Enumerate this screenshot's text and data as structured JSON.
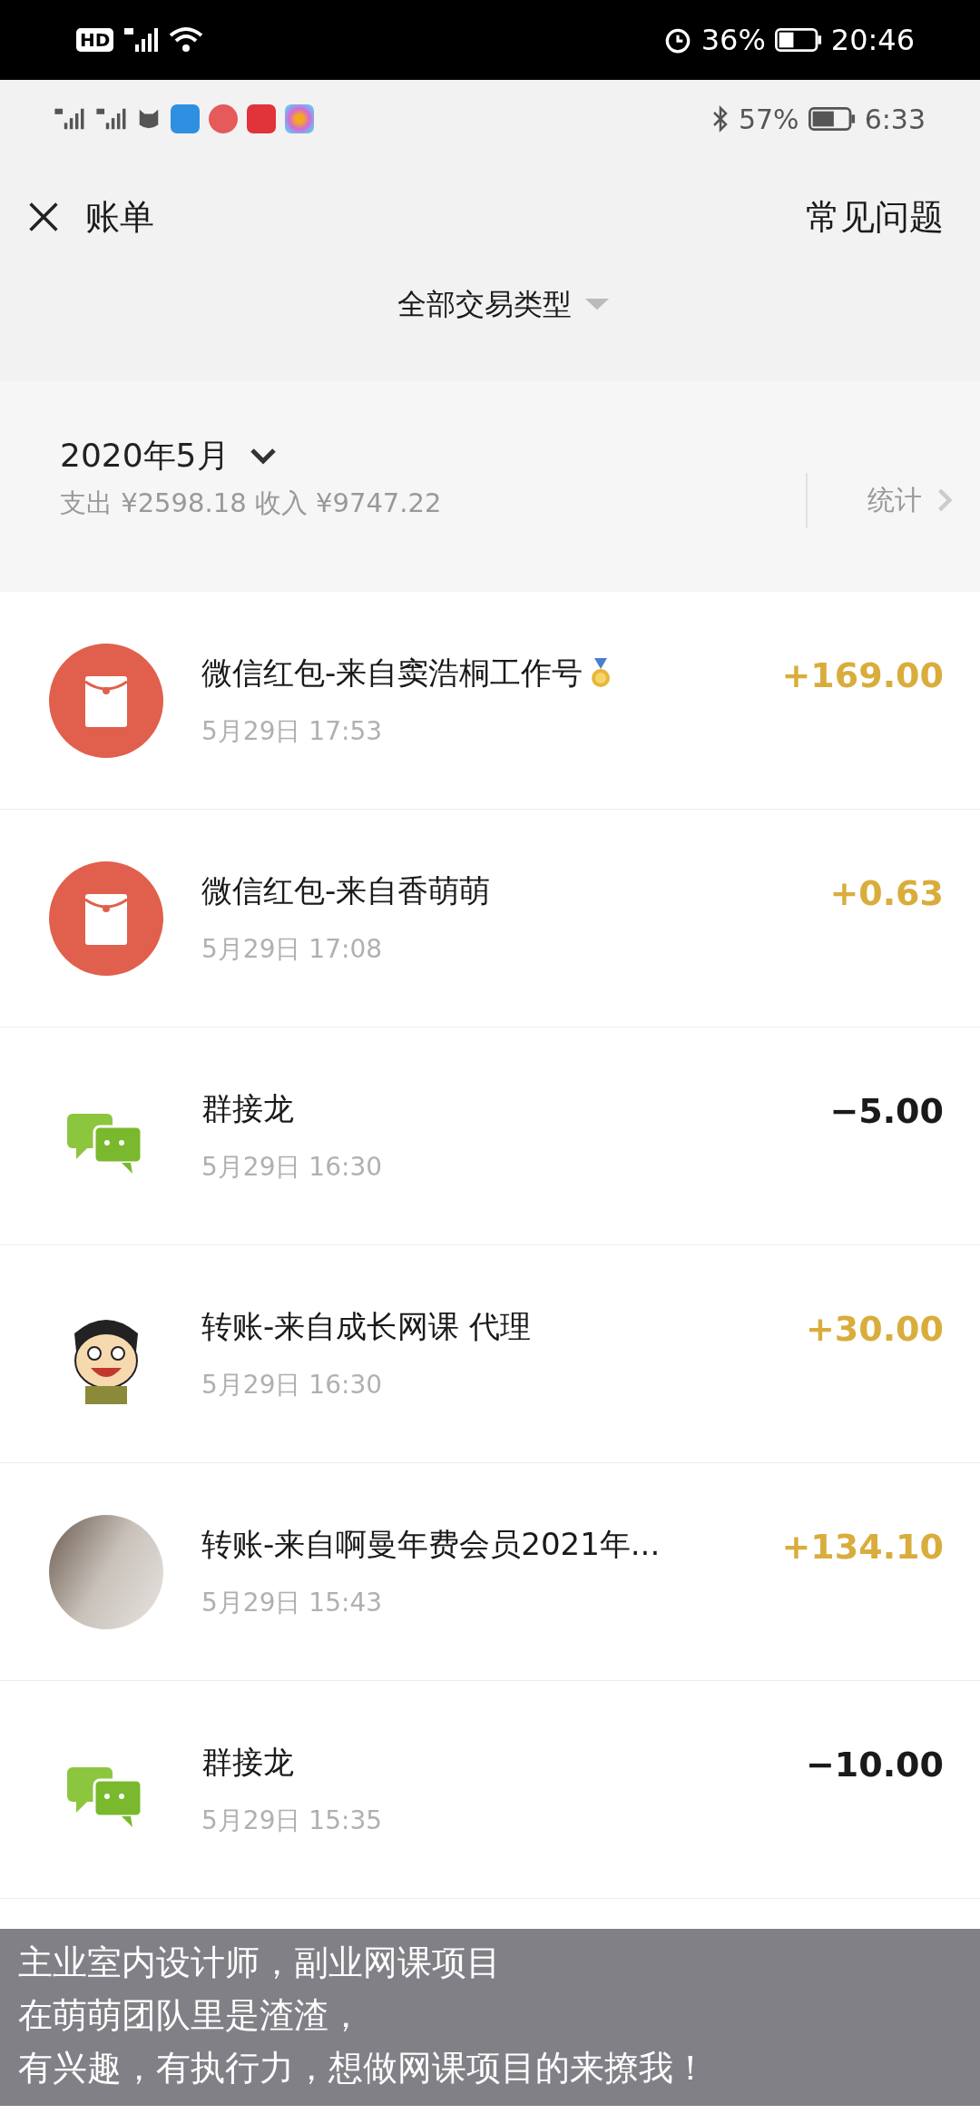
{
  "outer_status_bar": {
    "hd_badge": "HD",
    "battery_text": "36%",
    "time": "20:46"
  },
  "inner_status_bar": {
    "battery_text": "57%",
    "time": "6:33"
  },
  "header": {
    "title": "账单",
    "help_link": "常见问题"
  },
  "filter": {
    "label": "全部交易类型"
  },
  "month": {
    "label": "2020年5月",
    "summary": "支出 ¥2598.18 收入 ¥9747.22",
    "stats_link": "统计"
  },
  "transactions": [
    {
      "kind": "redpacket",
      "title": "微信红包-来自窦浩桐工作号",
      "medal": true,
      "time": "5月29日 17:53",
      "amount": "+169.00",
      "income": true
    },
    {
      "kind": "redpacket",
      "title": "微信红包-来自香萌萌",
      "medal": false,
      "time": "5月29日 17:08",
      "amount": "+0.63",
      "income": true
    },
    {
      "kind": "chat",
      "title": "群接龙",
      "medal": false,
      "time": "5月29日 16:30",
      "amount": "−5.00",
      "income": false
    },
    {
      "kind": "cartoon",
      "title": "转账-来自成长网课 代理",
      "medal": false,
      "time": "5月29日 16:30",
      "amount": "+30.00",
      "income": true
    },
    {
      "kind": "photo",
      "title": "转账-来自啊曼年费会员2021年...",
      "medal": false,
      "time": "5月29日 15:43",
      "amount": "+134.10",
      "income": true
    },
    {
      "kind": "chat",
      "title": "群接龙",
      "medal": false,
      "time": "5月29日 15:35",
      "amount": "−10.00",
      "income": false
    }
  ],
  "caption_overlay": {
    "lines": [
      "主业室内设计师，副业网课项目",
      "在萌萌团队里是渣渣，",
      "有兴趣，有执行力，想做网课项目的来撩我！"
    ]
  }
}
